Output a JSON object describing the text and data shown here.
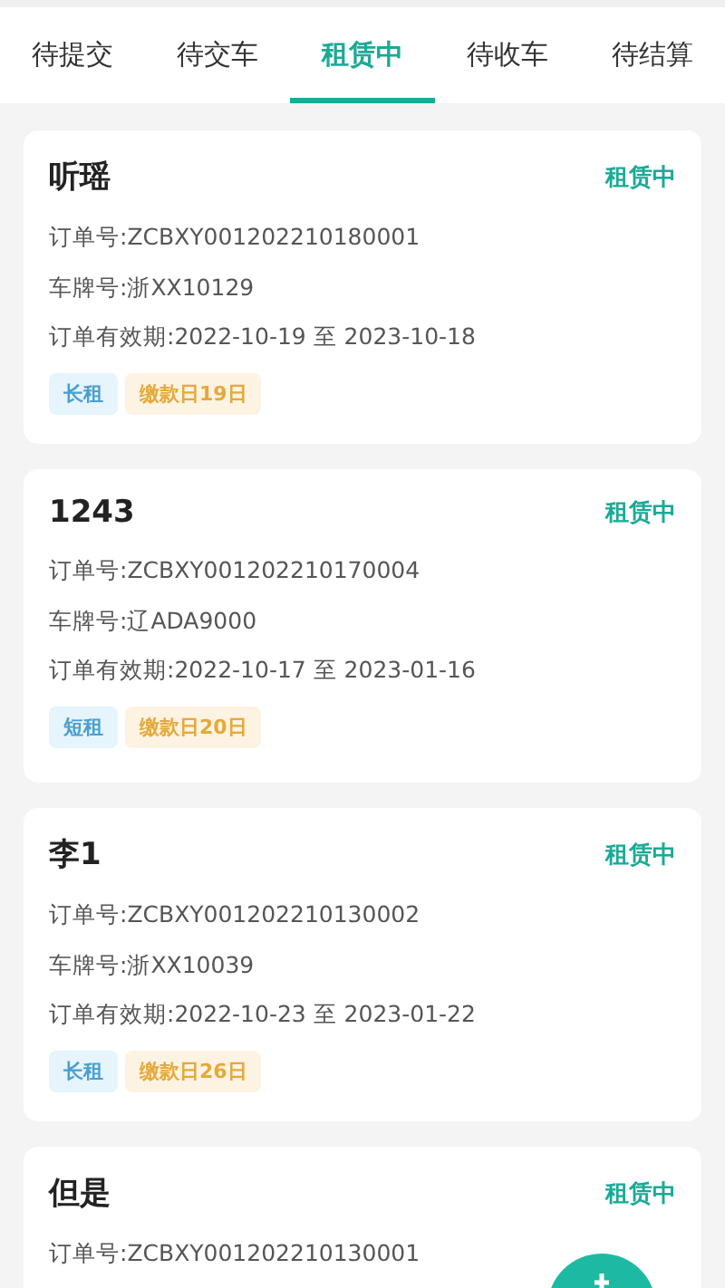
{
  "tabs": [
    {
      "label": "待提交",
      "selected": false
    },
    {
      "label": "待交车",
      "selected": false
    },
    {
      "label": "租赁中",
      "selected": true
    },
    {
      "label": "待收车",
      "selected": false
    },
    {
      "label": "待结算",
      "selected": false
    }
  ],
  "orders": [
    {
      "name": "听瑶",
      "status": "租赁中",
      "lines": [
        "订单号:ZCBXY001202210180001",
        "车牌号:浙XX10129",
        "订单有效期:2022-10-19 至 2023-10-18"
      ],
      "tags": [
        {
          "kind": "term",
          "label": "长租"
        },
        {
          "kind": "due",
          "label": "缴款日19日"
        }
      ]
    },
    {
      "name": "1243",
      "status": "租赁中",
      "lines": [
        "订单号:ZCBXY001202210170004",
        "车牌号:辽ADA9000",
        "订单有效期:2022-10-17 至 2023-01-16"
      ],
      "tags": [
        {
          "kind": "term",
          "label": "短租"
        },
        {
          "kind": "due",
          "label": "缴款日20日"
        }
      ]
    },
    {
      "name": "李1",
      "status": "租赁中",
      "lines": [
        "订单号:ZCBXY001202210130002",
        "车牌号:浙XX10039",
        "订单有效期:2022-10-23 至 2023-01-22"
      ],
      "tags": [
        {
          "kind": "term",
          "label": "长租"
        },
        {
          "kind": "due",
          "label": "缴款日26日"
        }
      ]
    },
    {
      "name": "但是",
      "status": "租赁中",
      "lines": [
        "订单号:ZCBXY001202210130001"
      ]
    }
  ],
  "fab": {
    "kind": "add"
  }
}
